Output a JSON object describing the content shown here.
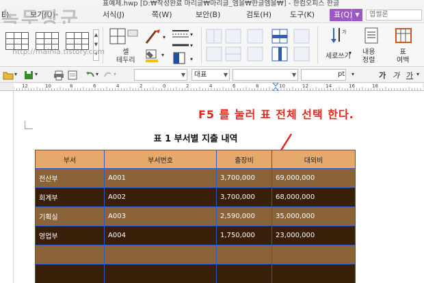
{
  "window": {
    "title": "표예제.hwp [D:₩작성완료 마리글₩마리글_엠을₩한글엠을₩] - 한컴오피스 한글"
  },
  "watermark": {
    "logo": "녹두장군",
    "url": "http://mainia.tistory.com"
  },
  "menubar": {
    "items": [
      {
        "label": "E)"
      },
      {
        "label": "보기(U)"
      },
      {
        "label": "서식(J)"
      },
      {
        "label": "쪽(W)"
      },
      {
        "label": "보안(B)"
      },
      {
        "label": "검토(H)"
      },
      {
        "label": "도구(K)"
      },
      {
        "label": "표(Q)"
      }
    ],
    "search_placeholder": "엽썰론"
  },
  "ribbon": {
    "cell_border_label": "셀\n테두리",
    "cell_border_label_1": "셀",
    "cell_border_label_2": "테두리",
    "vertical_text_label": "세로쓰기",
    "content_align_label_1": "내용",
    "content_align_label_2": "정렬",
    "table_margin_label_1": "표",
    "table_margin_label_2": "여백"
  },
  "toolbar": {
    "style_value": "",
    "font_type_value": "대표",
    "font_name_value": "",
    "font_size_value": "",
    "font_unit": "pt",
    "bold_label": "가",
    "italic_label": "가",
    "underline_label": "가"
  },
  "ruler": {
    "numbers": [
      "12",
      "10",
      "8",
      "6",
      "4",
      "2",
      "0",
      "2",
      "4",
      "6",
      "8",
      "10",
      "12",
      "14",
      "16",
      "18"
    ]
  },
  "document": {
    "annotation": "F5 를 눌러 표 전체 선택 한다.",
    "table_title": "표 1 부서별 지출 내역",
    "table": {
      "headers": [
        "부서",
        "부서번호",
        "출장비",
        "대외비"
      ],
      "rows": [
        [
          "전산부",
          "A001",
          "3,700,000",
          "69,000,000"
        ],
        [
          "회계부",
          "A002",
          "3,700,000",
          "68,000,000"
        ],
        [
          "기획실",
          "A003",
          "2,590,000",
          "35,000,000"
        ],
        [
          "영업부",
          "A004",
          "1,750,000",
          "23,000,000"
        ],
        [
          "",
          "",
          "",
          ""
        ],
        [
          "",
          "",
          "",
          ""
        ]
      ]
    }
  },
  "colors": {
    "table_header": "#e6a96c",
    "table_row_light": "#8b6338",
    "table_row_dark": "#3a1f08",
    "table_border": "#2b58c4",
    "annotation": "#e8231a",
    "menu_active": "#9c59c6"
  }
}
